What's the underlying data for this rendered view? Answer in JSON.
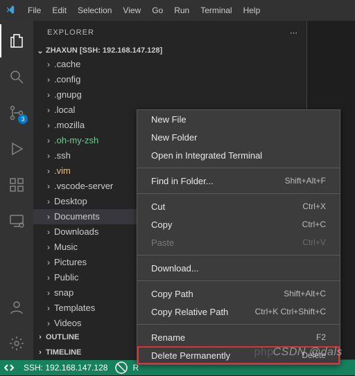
{
  "titlebar": {
    "menus": [
      "File",
      "Edit",
      "Selection",
      "View",
      "Go",
      "Run",
      "Terminal",
      "Help"
    ]
  },
  "activity": {
    "scm_badge": "3"
  },
  "sidebar": {
    "title": "EXPLORER",
    "project": "ZHAXUN [SSH: 192.168.147.128]",
    "items": [
      {
        "label": ".cache",
        "cls": ""
      },
      {
        "label": ".config",
        "cls": ""
      },
      {
        "label": ".gnupg",
        "cls": ""
      },
      {
        "label": ".local",
        "cls": ""
      },
      {
        "label": ".mozilla",
        "cls": ""
      },
      {
        "label": ".oh-my-zsh",
        "cls": "mod"
      },
      {
        "label": ".ssh",
        "cls": ""
      },
      {
        "label": ".vim",
        "cls": "warn"
      },
      {
        "label": ".vscode-server",
        "cls": ""
      },
      {
        "label": "Desktop",
        "cls": ""
      },
      {
        "label": "Documents",
        "cls": "selected"
      },
      {
        "label": "Downloads",
        "cls": ""
      },
      {
        "label": "Music",
        "cls": ""
      },
      {
        "label": "Pictures",
        "cls": ""
      },
      {
        "label": "Public",
        "cls": ""
      },
      {
        "label": "snap",
        "cls": ""
      },
      {
        "label": "Templates",
        "cls": ""
      },
      {
        "label": "Videos",
        "cls": ""
      }
    ],
    "sections": [
      "OUTLINE",
      "TIMELINE"
    ]
  },
  "contextMenu": {
    "groups": [
      [
        {
          "label": "New File",
          "sc": "",
          "disabled": false
        },
        {
          "label": "New Folder",
          "sc": "",
          "disabled": false
        },
        {
          "label": "Open in Integrated Terminal",
          "sc": "",
          "disabled": false
        }
      ],
      [
        {
          "label": "Find in Folder...",
          "sc": "Shift+Alt+F",
          "disabled": false
        }
      ],
      [
        {
          "label": "Cut",
          "sc": "Ctrl+X",
          "disabled": false
        },
        {
          "label": "Copy",
          "sc": "Ctrl+C",
          "disabled": false
        },
        {
          "label": "Paste",
          "sc": "Ctrl+V",
          "disabled": true
        }
      ],
      [
        {
          "label": "Download...",
          "sc": "",
          "disabled": false
        }
      ],
      [
        {
          "label": "Copy Path",
          "sc": "Shift+Alt+C",
          "disabled": false
        },
        {
          "label": "Copy Relative Path",
          "sc": "Ctrl+K Ctrl+Shift+C",
          "disabled": false
        }
      ],
      [
        {
          "label": "Rename",
          "sc": "F2",
          "disabled": false
        },
        {
          "label": "Delete Permanently",
          "sc": "Delete",
          "disabled": false,
          "highlight": true
        }
      ]
    ]
  },
  "status": {
    "remote": "SSH: 192.168.147.128",
    "r": "R"
  },
  "watermark": {
    "php": "php",
    "csdn": "CSDN @dals"
  }
}
